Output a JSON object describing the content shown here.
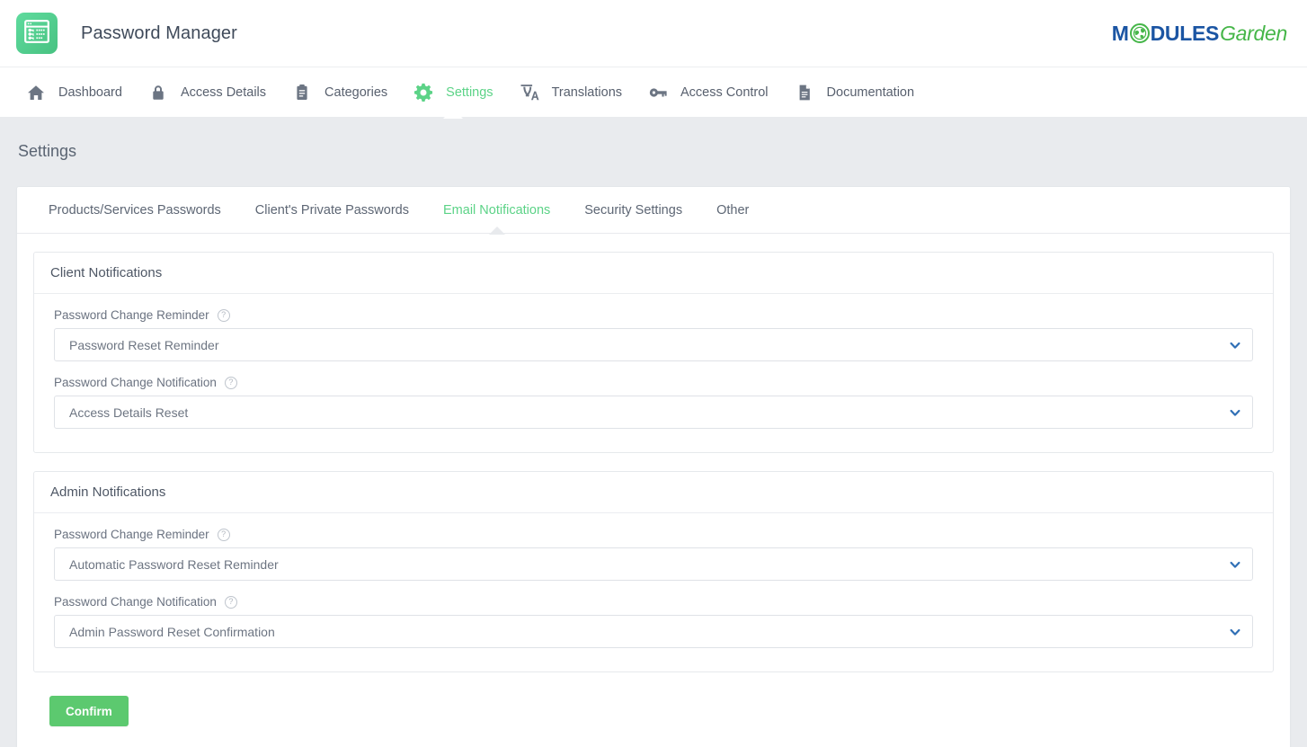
{
  "header": {
    "app_title": "Password Manager",
    "app_logo_icon": "password-window-icon",
    "brand": {
      "part1": "M",
      "globe_icon": "globe-icon",
      "part2": "DULES",
      "part3": "Garden",
      "blue": "#1b55a3",
      "green": "#46b649"
    }
  },
  "nav": {
    "items": [
      {
        "label": "Dashboard",
        "icon": "home-icon",
        "active": false
      },
      {
        "label": "Access Details",
        "icon": "lock-icon",
        "active": false
      },
      {
        "label": "Categories",
        "icon": "clipboard-icon",
        "active": false
      },
      {
        "label": "Settings",
        "icon": "gear-icon",
        "active": true
      },
      {
        "label": "Translations",
        "icon": "translate-icon",
        "active": false
      },
      {
        "label": "Access Control",
        "icon": "key-icon",
        "active": false
      },
      {
        "label": "Documentation",
        "icon": "document-icon",
        "active": false
      }
    ]
  },
  "page": {
    "title": "Settings",
    "accent_green": "#5cd387",
    "background": "#e9ebee"
  },
  "tabs": [
    {
      "label": "Products/Services Passwords",
      "active": false
    },
    {
      "label": "Client's Private Passwords",
      "active": false
    },
    {
      "label": "Email Notifications",
      "active": true
    },
    {
      "label": "Security Settings",
      "active": false
    },
    {
      "label": "Other",
      "active": false
    }
  ],
  "panels": [
    {
      "title": "Client Notifications",
      "fields": [
        {
          "label": "Password Change Reminder",
          "help_icon": "question-circle-icon",
          "value": "Password Reset Reminder",
          "chevron_icon": "chevron-down-icon"
        },
        {
          "label": "Password Change Notification",
          "help_icon": "question-circle-icon",
          "value": "Access Details Reset",
          "chevron_icon": "chevron-down-icon"
        }
      ]
    },
    {
      "title": "Admin Notifications",
      "fields": [
        {
          "label": "Password Change Reminder",
          "help_icon": "question-circle-icon",
          "value": "Automatic Password Reset Reminder",
          "chevron_icon": "chevron-down-icon"
        },
        {
          "label": "Password Change Notification",
          "help_icon": "question-circle-icon",
          "value": "Admin Password Reset Confirmation",
          "chevron_icon": "chevron-down-icon"
        }
      ]
    }
  ],
  "footer": {
    "confirm_label": "Confirm",
    "confirm_color": "#5cc96f"
  }
}
